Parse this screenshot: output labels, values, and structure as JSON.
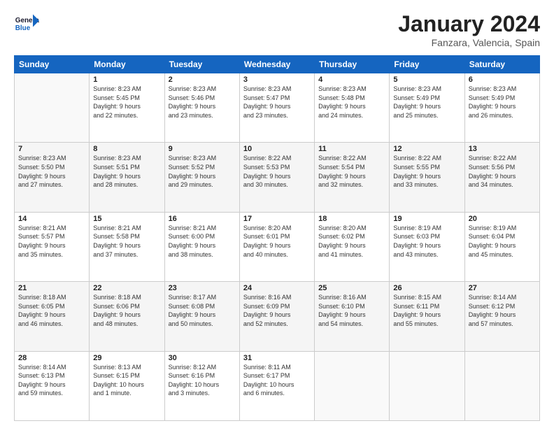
{
  "header": {
    "logo_general": "General",
    "logo_blue": "Blue",
    "month_title": "January 2024",
    "location": "Fanzara, Valencia, Spain"
  },
  "weekdays": [
    "Sunday",
    "Monday",
    "Tuesday",
    "Wednesday",
    "Thursday",
    "Friday",
    "Saturday"
  ],
  "weeks": [
    [
      {
        "day": "",
        "info": ""
      },
      {
        "day": "1",
        "info": "Sunrise: 8:23 AM\nSunset: 5:45 PM\nDaylight: 9 hours\nand 22 minutes."
      },
      {
        "day": "2",
        "info": "Sunrise: 8:23 AM\nSunset: 5:46 PM\nDaylight: 9 hours\nand 23 minutes."
      },
      {
        "day": "3",
        "info": "Sunrise: 8:23 AM\nSunset: 5:47 PM\nDaylight: 9 hours\nand 23 minutes."
      },
      {
        "day": "4",
        "info": "Sunrise: 8:23 AM\nSunset: 5:48 PM\nDaylight: 9 hours\nand 24 minutes."
      },
      {
        "day": "5",
        "info": "Sunrise: 8:23 AM\nSunset: 5:49 PM\nDaylight: 9 hours\nand 25 minutes."
      },
      {
        "day": "6",
        "info": "Sunrise: 8:23 AM\nSunset: 5:49 PM\nDaylight: 9 hours\nand 26 minutes."
      }
    ],
    [
      {
        "day": "7",
        "info": "Sunrise: 8:23 AM\nSunset: 5:50 PM\nDaylight: 9 hours\nand 27 minutes."
      },
      {
        "day": "8",
        "info": "Sunrise: 8:23 AM\nSunset: 5:51 PM\nDaylight: 9 hours\nand 28 minutes."
      },
      {
        "day": "9",
        "info": "Sunrise: 8:23 AM\nSunset: 5:52 PM\nDaylight: 9 hours\nand 29 minutes."
      },
      {
        "day": "10",
        "info": "Sunrise: 8:22 AM\nSunset: 5:53 PM\nDaylight: 9 hours\nand 30 minutes."
      },
      {
        "day": "11",
        "info": "Sunrise: 8:22 AM\nSunset: 5:54 PM\nDaylight: 9 hours\nand 32 minutes."
      },
      {
        "day": "12",
        "info": "Sunrise: 8:22 AM\nSunset: 5:55 PM\nDaylight: 9 hours\nand 33 minutes."
      },
      {
        "day": "13",
        "info": "Sunrise: 8:22 AM\nSunset: 5:56 PM\nDaylight: 9 hours\nand 34 minutes."
      }
    ],
    [
      {
        "day": "14",
        "info": "Sunrise: 8:21 AM\nSunset: 5:57 PM\nDaylight: 9 hours\nand 35 minutes."
      },
      {
        "day": "15",
        "info": "Sunrise: 8:21 AM\nSunset: 5:58 PM\nDaylight: 9 hours\nand 37 minutes."
      },
      {
        "day": "16",
        "info": "Sunrise: 8:21 AM\nSunset: 6:00 PM\nDaylight: 9 hours\nand 38 minutes."
      },
      {
        "day": "17",
        "info": "Sunrise: 8:20 AM\nSunset: 6:01 PM\nDaylight: 9 hours\nand 40 minutes."
      },
      {
        "day": "18",
        "info": "Sunrise: 8:20 AM\nSunset: 6:02 PM\nDaylight: 9 hours\nand 41 minutes."
      },
      {
        "day": "19",
        "info": "Sunrise: 8:19 AM\nSunset: 6:03 PM\nDaylight: 9 hours\nand 43 minutes."
      },
      {
        "day": "20",
        "info": "Sunrise: 8:19 AM\nSunset: 6:04 PM\nDaylight: 9 hours\nand 45 minutes."
      }
    ],
    [
      {
        "day": "21",
        "info": "Sunrise: 8:18 AM\nSunset: 6:05 PM\nDaylight: 9 hours\nand 46 minutes."
      },
      {
        "day": "22",
        "info": "Sunrise: 8:18 AM\nSunset: 6:06 PM\nDaylight: 9 hours\nand 48 minutes."
      },
      {
        "day": "23",
        "info": "Sunrise: 8:17 AM\nSunset: 6:08 PM\nDaylight: 9 hours\nand 50 minutes."
      },
      {
        "day": "24",
        "info": "Sunrise: 8:16 AM\nSunset: 6:09 PM\nDaylight: 9 hours\nand 52 minutes."
      },
      {
        "day": "25",
        "info": "Sunrise: 8:16 AM\nSunset: 6:10 PM\nDaylight: 9 hours\nand 54 minutes."
      },
      {
        "day": "26",
        "info": "Sunrise: 8:15 AM\nSunset: 6:11 PM\nDaylight: 9 hours\nand 55 minutes."
      },
      {
        "day": "27",
        "info": "Sunrise: 8:14 AM\nSunset: 6:12 PM\nDaylight: 9 hours\nand 57 minutes."
      }
    ],
    [
      {
        "day": "28",
        "info": "Sunrise: 8:14 AM\nSunset: 6:13 PM\nDaylight: 9 hours\nand 59 minutes."
      },
      {
        "day": "29",
        "info": "Sunrise: 8:13 AM\nSunset: 6:15 PM\nDaylight: 10 hours\nand 1 minute."
      },
      {
        "day": "30",
        "info": "Sunrise: 8:12 AM\nSunset: 6:16 PM\nDaylight: 10 hours\nand 3 minutes."
      },
      {
        "day": "31",
        "info": "Sunrise: 8:11 AM\nSunset: 6:17 PM\nDaylight: 10 hours\nand 6 minutes."
      },
      {
        "day": "",
        "info": ""
      },
      {
        "day": "",
        "info": ""
      },
      {
        "day": "",
        "info": ""
      }
    ]
  ]
}
